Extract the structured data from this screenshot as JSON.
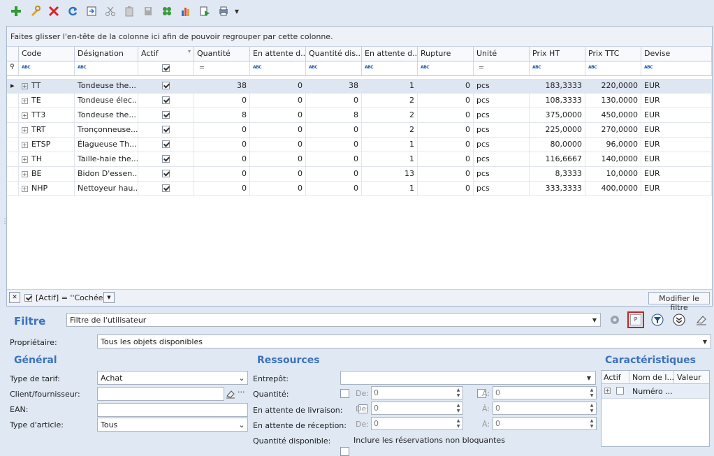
{
  "toolbar": {
    "buttons": [
      "add-icon",
      "edit-icon",
      "delete-icon",
      "refresh-icon",
      "export-icon",
      "cut-icon",
      "paste-icon",
      "save-icon",
      "settings-icon",
      "chart-icon",
      "run-icon",
      "print-icon"
    ]
  },
  "grid": {
    "group_hint": "Faites glisser l'en-tête de la colonne ici afin de pouvoir regrouper par cette colonne.",
    "columns": [
      "Code",
      "Désignation",
      "Actif",
      "Quantité",
      "En attente d...",
      "Quantité dis...",
      "En attente d...",
      "Rupture",
      "Unité",
      "Prix HT",
      "Prix TTC",
      "Devise"
    ],
    "rows": [
      {
        "code": "TT",
        "designation": "Tondeuse the...",
        "actif": true,
        "quantite": "38",
        "att1": "0",
        "dispo": "38",
        "att2": "1",
        "rupture": "0",
        "unite": "pcs",
        "prix_ht": "183,3333",
        "prix_ttc": "220,0000",
        "devise": "EUR"
      },
      {
        "code": "TE",
        "designation": "Tondeuse élec...",
        "actif": true,
        "quantite": "0",
        "att1": "0",
        "dispo": "0",
        "att2": "2",
        "rupture": "0",
        "unite": "pcs",
        "prix_ht": "108,3333",
        "prix_ttc": "130,0000",
        "devise": "EUR"
      },
      {
        "code": "TT3",
        "designation": "Tondeuse the...",
        "actif": true,
        "quantite": "8",
        "att1": "0",
        "dispo": "8",
        "att2": "2",
        "rupture": "0",
        "unite": "pcs",
        "prix_ht": "375,0000",
        "prix_ttc": "450,0000",
        "devise": "EUR"
      },
      {
        "code": "TRT",
        "designation": "Tronçonneuse...",
        "actif": true,
        "quantite": "0",
        "att1": "0",
        "dispo": "0",
        "att2": "2",
        "rupture": "0",
        "unite": "pcs",
        "prix_ht": "225,0000",
        "prix_ttc": "270,0000",
        "devise": "EUR"
      },
      {
        "code": "ETSP",
        "designation": "Élagueuse Th...",
        "actif": true,
        "quantite": "0",
        "att1": "0",
        "dispo": "0",
        "att2": "1",
        "rupture": "0",
        "unite": "pcs",
        "prix_ht": "80,0000",
        "prix_ttc": "96,0000",
        "devise": "EUR"
      },
      {
        "code": "TH",
        "designation": "Taille-haie the...",
        "actif": true,
        "quantite": "0",
        "att1": "0",
        "dispo": "0",
        "att2": "1",
        "rupture": "0",
        "unite": "pcs",
        "prix_ht": "116,6667",
        "prix_ttc": "140,0000",
        "devise": "EUR"
      },
      {
        "code": "BE",
        "designation": "Bidon D'essen...",
        "actif": true,
        "quantite": "0",
        "att1": "0",
        "dispo": "0",
        "att2": "13",
        "rupture": "0",
        "unite": "pcs",
        "prix_ht": "8,3333",
        "prix_ttc": "10,0000",
        "devise": "EUR"
      },
      {
        "code": "NHP",
        "designation": "Nettoyeur hau...",
        "actif": true,
        "quantite": "0",
        "att1": "0",
        "dispo": "0",
        "att2": "1",
        "rupture": "0",
        "unite": "pcs",
        "prix_ht": "333,3333",
        "prix_ttc": "400,0000",
        "devise": "EUR"
      }
    ],
    "filter_text": "[Actif] = ''Cochée''",
    "edit_filter_label": "Modifier le filtre"
  },
  "filter": {
    "title": "Filtre",
    "value": "Filtre de l'utilisateur",
    "p_label": "P"
  },
  "owner": {
    "label": "Propriétaire:",
    "value": "Tous les objets disponibles"
  },
  "general": {
    "title": "Général",
    "tarif_label": "Type de tarif:",
    "tarif_value": "Achat",
    "client_label": "Client/fournisseur:",
    "client_value": "",
    "ean_label": "EAN:",
    "ean_value": "",
    "type_label": "Type d'article:",
    "type_value": "Tous"
  },
  "resources": {
    "title": "Ressources",
    "entrepot_label": "Entrepôt:",
    "entrepot_value": "",
    "quantite_label": "Quantité:",
    "livraison_label": "En attente de livraison:",
    "reception_label": "En attente de réception:",
    "dispo_label": "Quantité disponible:",
    "reservations_label": "Inclure les réservations non bloquantes",
    "de_label": "De:",
    "a_label": "À:",
    "zero": "0"
  },
  "characteristics": {
    "title": "Caractéristiques",
    "columns": [
      "Actif",
      "Nom de l...",
      "Valeur"
    ],
    "row_name": "Numéro ..."
  }
}
